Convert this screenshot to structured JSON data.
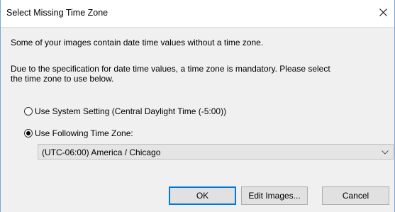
{
  "window": {
    "title": "Select Missing Time Zone",
    "close_icon": "close-icon"
  },
  "message": {
    "line1": "Some of your images contain date time values without a time zone.",
    "line2a": "Due to the specification for date time values, a time zone is mandatory. Please select",
    "line2b": "the time zone to use below."
  },
  "options": {
    "system_setting_label": "Use System Setting (Central Daylight Time (-5:00))",
    "system_setting_checked": false,
    "following_label": "Use Following Time Zone:",
    "following_checked": true
  },
  "timezone_select": {
    "selected": "(UTC-06:00) America / Chicago",
    "icon": "chevron-down-icon"
  },
  "buttons": {
    "ok": "OK",
    "edit_images": "Edit Images...",
    "cancel": "Cancel"
  },
  "colors": {
    "accent": "#0078d7",
    "window_border": "#7aa7d6",
    "content_bg": "#f0f0f0"
  }
}
